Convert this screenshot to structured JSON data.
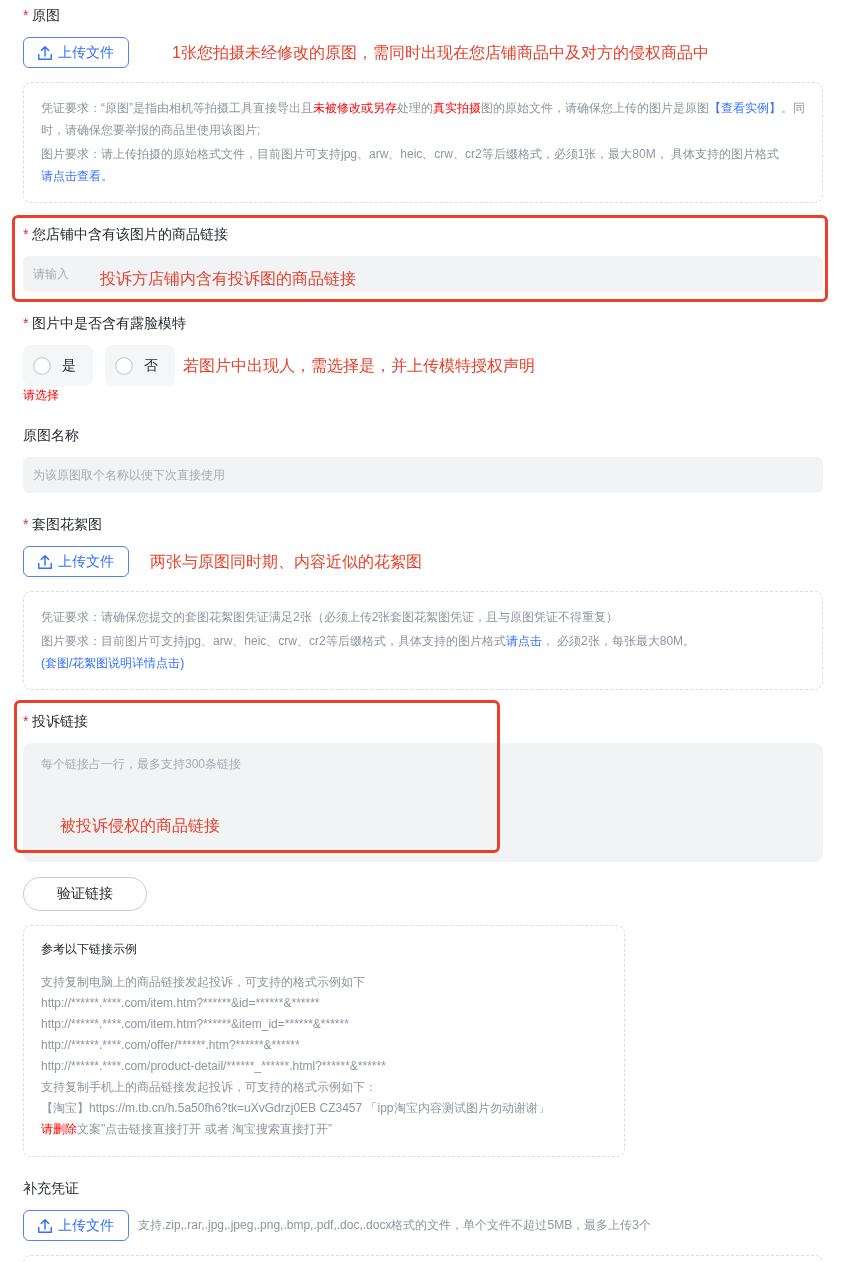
{
  "sections": [
    {
      "kind": "upload",
      "marker": "*",
      "label": "原图",
      "button": "上传文件",
      "annotation": "1张您拍摄未经修改的原图，需同时出现在您店铺商品中及对方的侵权商品中",
      "notice": [
        [
          {
            "kind": "plain",
            "text": "凭证要求：“原图”是指由相机等拍摄工具直接导出且"
          },
          {
            "kind": "alert",
            "text": "未被修改或另存"
          },
          {
            "kind": "plain",
            "text": "处理的"
          },
          {
            "kind": "alert",
            "text": "真实拍摄"
          },
          {
            "kind": "plain",
            "text": "图的原始文件，请确保您上传的图片是原图"
          },
          {
            "kind": "link",
            "text": "【查看实例】"
          },
          {
            "kind": "plain",
            "text": "。同时，请确保您要举报的商品里使用该图片;"
          }
        ],
        [
          {
            "kind": "plain",
            "text": "图片要求：请上传拍摄的原始格式文件，目前图片可支持jpg、arw、heic、crw、cr2等后缀格式，必须1张，最大80M， 具体支持的图片格式"
          },
          {
            "kind": "link",
            "text": "请点击查看。"
          }
        ]
      ]
    },
    {
      "kind": "input",
      "marker": "*",
      "label": "您店铺中含有该图片的商品链接",
      "placeholder": "请输入",
      "annotation": "投诉方店铺内含有投诉图的商品链接",
      "highlighted": true
    },
    {
      "kind": "radio",
      "marker": "*",
      "label": "图片中是否含有露脸模特",
      "options": [
        {
          "label": "是",
          "selected": false
        },
        {
          "label": "否",
          "selected": false
        }
      ],
      "annotation": "若图片中出现人，需选择是，并上传模特授权声明",
      "error": "请选择"
    },
    {
      "kind": "input",
      "label": "原图名称",
      "placeholder": "为该原图取个名称以便下次直接使用"
    },
    {
      "kind": "upload",
      "marker": "*",
      "label": "套图花絮图",
      "button": "上传文件",
      "annotation": "两张与原图同时期、内容近似的花絮图",
      "notice": [
        [
          {
            "kind": "plain",
            "text": "凭证要求：请确保您提交的套图花絮图凭证满足2张（必须上传2张套图花絮图凭证，且与原图凭证不得重复）"
          }
        ],
        [
          {
            "kind": "plain",
            "text": "图片要求：目前图片可支持jpg、arw、heic、crw、cr2等后缀格式，具体支持的图片格式"
          },
          {
            "kind": "link",
            "text": "请点击"
          },
          {
            "kind": "plain",
            "text": "， 必须2张，每张最大80M。"
          },
          {
            "kind": "link",
            "text": "(套图/花絮图说明详情点击)"
          }
        ]
      ]
    },
    {
      "kind": "textarea",
      "marker": "*",
      "label": "投诉链接",
      "placeholder": "每个链接占一行，最多支持300条链接",
      "annotation": "被投诉侵权的商品链接",
      "highlighted": true,
      "button": "验证链接",
      "examples": {
        "title": "参考以下链接示例",
        "lines": [
          {
            "text": "支持复制电脑上的商品链接发起投诉，可支持的格式示例如下"
          },
          {
            "text": "http://******.****.com/item.htm?******&id=******&******"
          },
          {
            "text": "http://******.****.com/item.htm?******&item_id=******&******"
          },
          {
            "text": "http://******.****.com/offer/******.htm?******&******"
          },
          {
            "text": "http://******.****.com/product-detail/******_******.html?******&******"
          },
          {
            "text": "支持复制手机上的商品链接发起投诉，可支持的格式示例如下："
          },
          {
            "text": "【淘宝】https://m.tb.cn/h.5a50fh6?tk=uXvGdrzj0EB CZ3457 「ipp淘宝内容测试图片勿动谢谢」"
          },
          {
            "alert": "请删除",
            "text": "文案\"点击链接直接打开 或者 淘宝搜索直接打开”"
          }
        ]
      }
    },
    {
      "kind": "upload",
      "label": "补充凭证",
      "button": "上传文件",
      "hint": "支持.zip,.rar,.jpg,.jpeg,.png,.bmp,.pdf,.doc,.docx格式的文件，单个文件不超过5MB，最多上传3个",
      "dropzone": true
    }
  ]
}
